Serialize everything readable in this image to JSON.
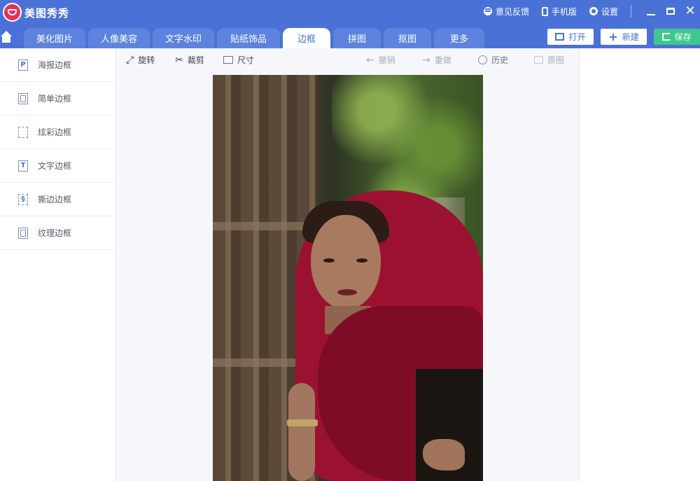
{
  "titlebar": {
    "app_title": "美图秀秀",
    "feedback_label": "意见反馈",
    "mobile_label": "手机版",
    "settings_label": "设置"
  },
  "tabs": [
    {
      "label": "美化图片"
    },
    {
      "label": "人像美容"
    },
    {
      "label": "文字水印"
    },
    {
      "label": "贴纸饰品"
    },
    {
      "label": "边框",
      "active": true
    },
    {
      "label": "拼图"
    },
    {
      "label": "抠图"
    },
    {
      "label": "更多"
    }
  ],
  "actions": {
    "open_label": "打开",
    "new_label": "新建",
    "save_label": "保存"
  },
  "sidebar": {
    "items": [
      {
        "label": "海报边框",
        "icon": "poster-frame-icon"
      },
      {
        "label": "简单边框",
        "icon": "simple-frame-icon"
      },
      {
        "label": "炫彩边框",
        "icon": "colorful-frame-icon"
      },
      {
        "label": "文字边框",
        "icon": "text-frame-icon"
      },
      {
        "label": "撕边边框",
        "icon": "torn-frame-icon"
      },
      {
        "label": "纹理边框",
        "icon": "texture-frame-icon"
      }
    ]
  },
  "toolbar": {
    "rotate_label": "旋转",
    "crop_label": "裁剪",
    "size_label": "尺寸",
    "undo_label": "撤销",
    "redo_label": "重做",
    "history_label": "历史",
    "original_label": "原图"
  },
  "colors": {
    "brand_blue": "#4a72d6",
    "save_green": "#3fc88d",
    "logo_pink": "#e7305a"
  }
}
